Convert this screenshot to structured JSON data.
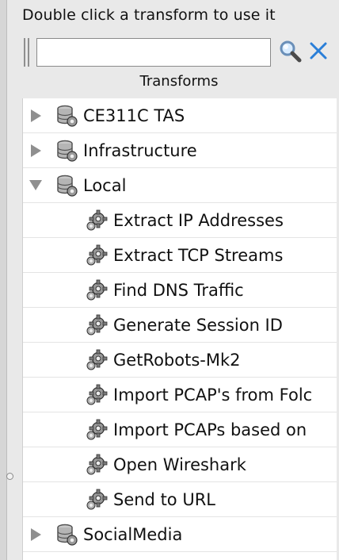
{
  "header": {
    "instruction": "Double click a transform to use it"
  },
  "search": {
    "value": "",
    "placeholder": ""
  },
  "panel": {
    "title": "Transforms"
  },
  "tree": {
    "categories": [
      {
        "label": "CE311C TAS",
        "expanded": false
      },
      {
        "label": "Infrastructure",
        "expanded": false
      },
      {
        "label": "Local",
        "expanded": true,
        "transforms": [
          "Extract IP Addresses",
          "Extract TCP Streams",
          "Find DNS Traffic",
          "Generate Session ID",
          "GetRobots-Mk2",
          "Import PCAP's from Folc",
          "Import PCAPs based on",
          "Open Wireshark",
          "Send to URL"
        ]
      },
      {
        "label": "SocialMedia",
        "expanded": false
      }
    ]
  },
  "icons": {
    "category": "server-database-icon",
    "transform": "gear-icon",
    "search": "magnifier-icon",
    "clear": "close-icon"
  },
  "colors": {
    "clear_icon": "#2a7fd8",
    "arrow": "#8f8f8f"
  }
}
